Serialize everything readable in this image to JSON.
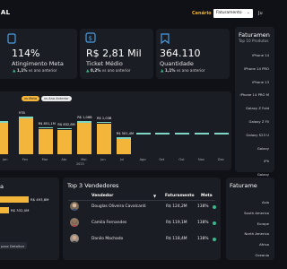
{
  "header": {
    "title": "IAL",
    "cenario_label": "Cenário",
    "cenario_value": "Faturamento",
    "extra": "Ju"
  },
  "kpis": [
    {
      "value": "114%",
      "label": "Atingimento Meta",
      "delta": "1,1%",
      "delta_text": "vs ano anterior"
    },
    {
      "value": "R$ 2,81 Mil",
      "label": "Ticket Médio",
      "delta": "0,2%",
      "delta_text": "vs ano anterior"
    },
    {
      "value": "364.110",
      "label": "Quantidade",
      "delta": "1,1%",
      "delta_text": "vs ano anterior"
    }
  ],
  "monthly": {
    "toggle_on": "vs Meta",
    "toggle_off": "vs Ano Anterior",
    "year": "2023",
    "months": [
      "Jan",
      "Fev",
      "Mar",
      "Abr",
      "Mai",
      "Jun",
      "Jul",
      "Ago",
      "Set",
      "Out",
      "Nov",
      "Dez"
    ],
    "labels": [
      "",
      "97B",
      "R$ 851,1M",
      "R$ 832,8M",
      "R$ 1,06B",
      "R$ 1,03B",
      "R$ 501,4M",
      "",
      "",
      "",
      "",
      ""
    ]
  },
  "chart_data": {
    "type": "bar",
    "categories": [
      "Jan",
      "Fev",
      "Mar",
      "Abr",
      "Mai",
      "Jun",
      "Jul",
      "Ago",
      "Set",
      "Out",
      "Nov",
      "Dez"
    ],
    "values": [
      null,
      null,
      851.1,
      832.8,
      1060,
      1030,
      501.4,
      null,
      null,
      null,
      null,
      null
    ],
    "xlabel": "2023"
  },
  "products": {
    "title": "Faturamen",
    "subtitle": "Top 10 Produtos",
    "items": [
      "iPhone 14",
      "iPhone 14 PRO",
      "iPhone 13",
      "iPhone 14 PRO M",
      "Galaxy Z Fold",
      "Galaxy Z Fli",
      "Galaxy S23 U",
      "Galaxy",
      "iPh",
      "Galaxy"
    ]
  },
  "left_bottom": {
    "title": "a",
    "values": [
      "R$ 493,8M",
      "R$ 332,0M"
    ],
    "hint": "para Detalhar"
  },
  "sellers": {
    "title": "Top 3 Vendedores",
    "col_vendedor": "Vendedor",
    "col_fat": "Faturamento",
    "col_meta": "Meta",
    "rows": [
      {
        "name": "Douglas Oliveira Cavalcanti",
        "fat": "R$ 124,2M",
        "meta": "138%"
      },
      {
        "name": "Camila Fernandes",
        "fat": "R$ 119,1M",
        "meta": "138%"
      },
      {
        "name": "Danilo Machado",
        "fat": "R$ 118,4M",
        "meta": "138%"
      }
    ]
  },
  "regions": {
    "title": "Faturame",
    "items": [
      "Asia",
      "South America",
      "Europe",
      "North America",
      "Africa",
      "Oceania"
    ]
  }
}
